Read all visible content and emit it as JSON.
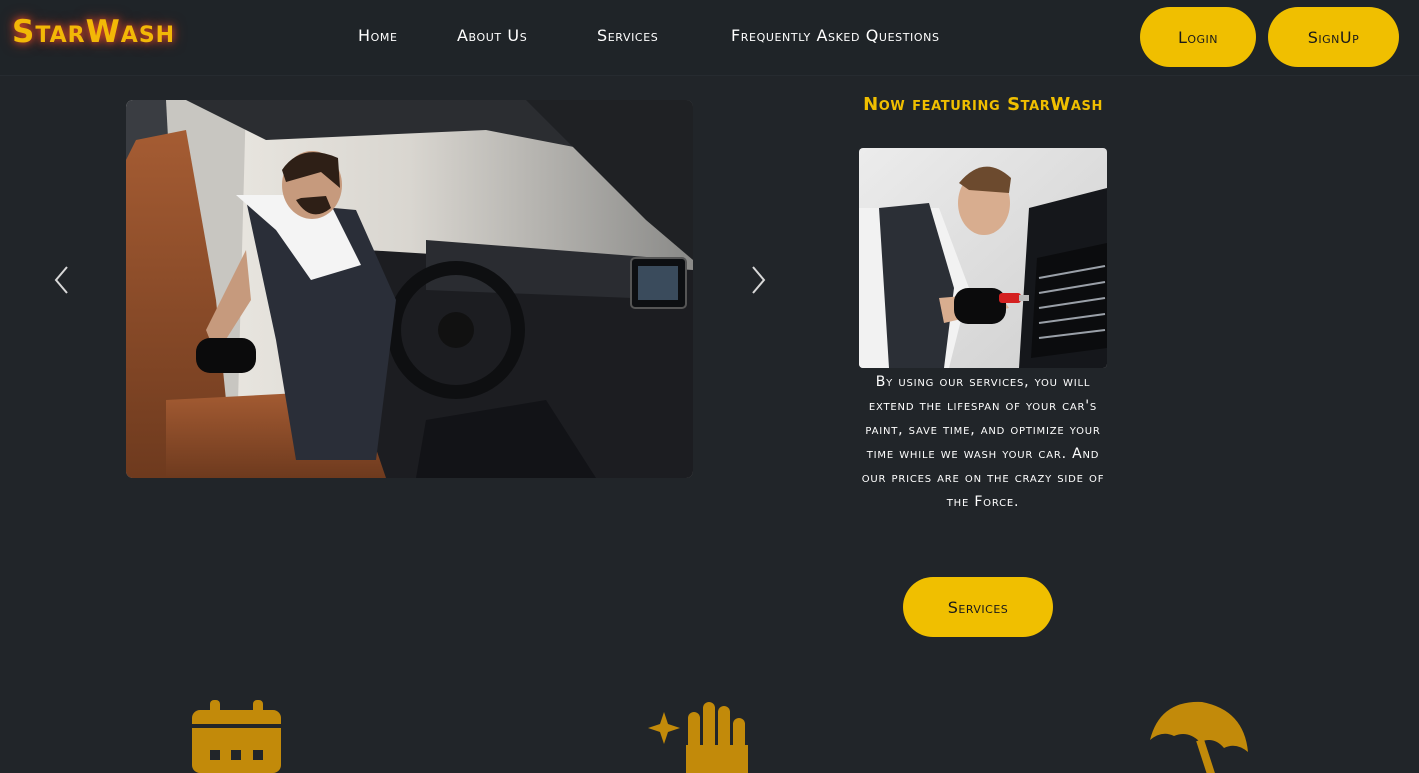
{
  "brand": {
    "name": "StarWash"
  },
  "nav": {
    "links": [
      {
        "label": "Home"
      },
      {
        "label": "About Us"
      },
      {
        "label": "Services"
      },
      {
        "label": "Frequently Asked Questions"
      }
    ],
    "login_label": "Login",
    "signup_label": "SignUp"
  },
  "carousel": {
    "prev_icon": "chevron-left-icon",
    "next_icon": "chevron-right-icon",
    "slide_image": "mechanic cleaning car interior"
  },
  "feature": {
    "heading": "Now featuring StarWash",
    "image": "technician detailing car grille with brush",
    "text": "By using our services, you will extend the lifespan of your car's paint, save time, and optimize your time while we wash your car. And our prices are on the crazy side of the Force.",
    "button_label": "Services"
  },
  "bottom_icons": [
    {
      "name": "calendar-icon"
    },
    {
      "name": "sparkle-hand-icon"
    },
    {
      "name": "umbrella-icon"
    }
  ],
  "colors": {
    "background": "#212529",
    "accent": "#f0bf00",
    "brand_glow": "#ff5028",
    "icon": "#c28a0a"
  }
}
